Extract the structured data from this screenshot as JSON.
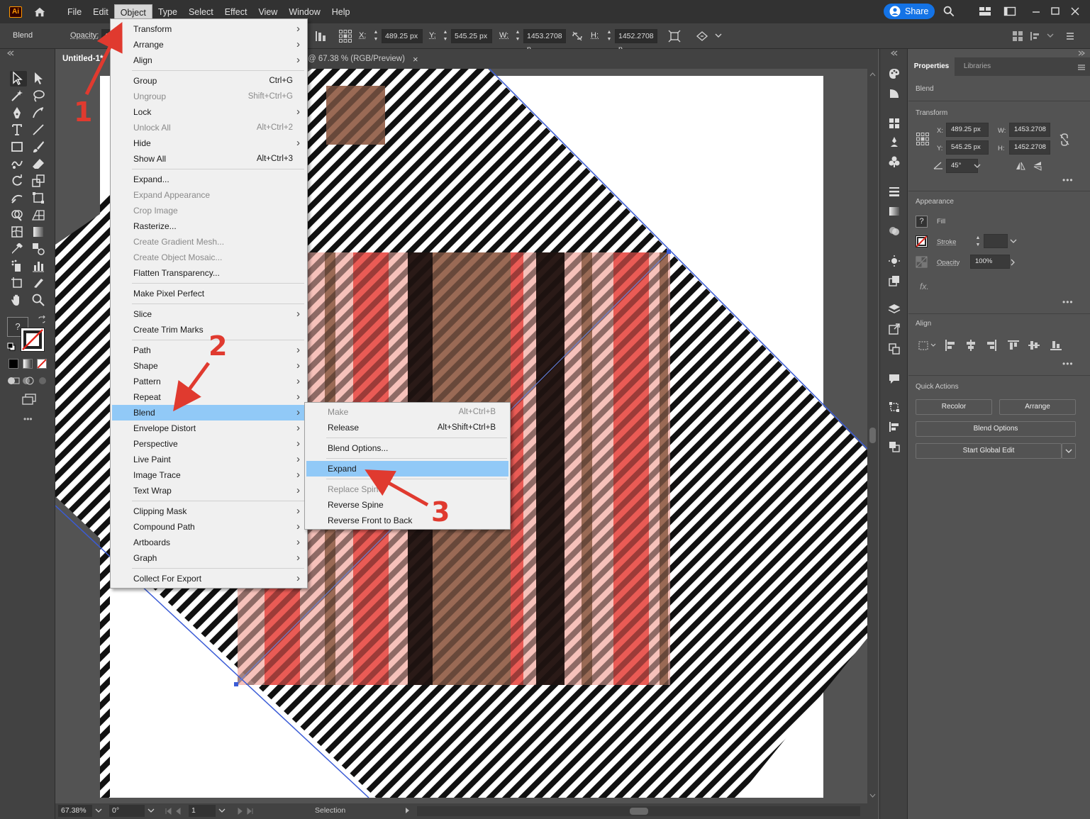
{
  "menubar": {
    "logo": "Ai",
    "items": [
      "File",
      "Edit",
      "Object",
      "Type",
      "Select",
      "Effect",
      "View",
      "Window",
      "Help"
    ],
    "active_item": "Object",
    "share_label": "Share"
  },
  "controlbar": {
    "selection_label": "Blend",
    "opacity_label": "Opacity:",
    "opacity_value": "10",
    "x_label": "X:",
    "x_value": "489.25 px",
    "y_label": "Y:",
    "y_value": "545.25 px",
    "w_label": "W:",
    "w_value": "1453.2708 p",
    "h_label": "H:",
    "h_value": "1452.2708 p"
  },
  "document": {
    "tab_title": "Untitled-1*",
    "tab_suffix": "@ 67.38 % (RGB/Preview)",
    "close_glyph": "×"
  },
  "object_menu": {
    "items": [
      {
        "label": "Transform",
        "shortcut": "",
        "submenu": true,
        "disabled": false
      },
      {
        "label": "Arrange",
        "shortcut": "",
        "submenu": true,
        "disabled": false
      },
      {
        "label": "Align",
        "shortcut": "",
        "submenu": true,
        "disabled": false
      },
      {
        "label": "Group",
        "shortcut": "Ctrl+G",
        "submenu": false,
        "disabled": false
      },
      {
        "label": "Ungroup",
        "shortcut": "Shift+Ctrl+G",
        "submenu": false,
        "disabled": true
      },
      {
        "label": "Lock",
        "shortcut": "",
        "submenu": true,
        "disabled": false
      },
      {
        "label": "Unlock All",
        "shortcut": "Alt+Ctrl+2",
        "submenu": false,
        "disabled": true
      },
      {
        "label": "Hide",
        "shortcut": "",
        "submenu": true,
        "disabled": false
      },
      {
        "label": "Show All",
        "shortcut": "Alt+Ctrl+3",
        "submenu": false,
        "disabled": false
      },
      {
        "label": "Expand...",
        "shortcut": "",
        "submenu": false,
        "disabled": false
      },
      {
        "label": "Expand Appearance",
        "shortcut": "",
        "submenu": false,
        "disabled": true
      },
      {
        "label": "Crop Image",
        "shortcut": "",
        "submenu": false,
        "disabled": true
      },
      {
        "label": "Rasterize...",
        "shortcut": "",
        "submenu": false,
        "disabled": false
      },
      {
        "label": "Create Gradient Mesh...",
        "shortcut": "",
        "submenu": false,
        "disabled": true
      },
      {
        "label": "Create Object Mosaic...",
        "shortcut": "",
        "submenu": false,
        "disabled": true
      },
      {
        "label": "Flatten Transparency...",
        "shortcut": "",
        "submenu": false,
        "disabled": false
      },
      {
        "label": "Make Pixel Perfect",
        "shortcut": "",
        "submenu": false,
        "disabled": false
      },
      {
        "label": "Slice",
        "shortcut": "",
        "submenu": true,
        "disabled": false
      },
      {
        "label": "Create Trim Marks",
        "shortcut": "",
        "submenu": false,
        "disabled": false
      },
      {
        "label": "Path",
        "shortcut": "",
        "submenu": true,
        "disabled": false
      },
      {
        "label": "Shape",
        "shortcut": "",
        "submenu": true,
        "disabled": false
      },
      {
        "label": "Pattern",
        "shortcut": "",
        "submenu": true,
        "disabled": false
      },
      {
        "label": "Repeat",
        "shortcut": "",
        "submenu": true,
        "disabled": false
      },
      {
        "label": "Blend",
        "shortcut": "",
        "submenu": true,
        "disabled": false,
        "highlight": true
      },
      {
        "label": "Envelope Distort",
        "shortcut": "",
        "submenu": true,
        "disabled": false
      },
      {
        "label": "Perspective",
        "shortcut": "",
        "submenu": true,
        "disabled": false
      },
      {
        "label": "Live Paint",
        "shortcut": "",
        "submenu": true,
        "disabled": false
      },
      {
        "label": "Image Trace",
        "shortcut": "",
        "submenu": true,
        "disabled": false
      },
      {
        "label": "Text Wrap",
        "shortcut": "",
        "submenu": true,
        "disabled": false
      },
      {
        "label": "Clipping Mask",
        "shortcut": "",
        "submenu": true,
        "disabled": false
      },
      {
        "label": "Compound Path",
        "shortcut": "",
        "submenu": true,
        "disabled": false
      },
      {
        "label": "Artboards",
        "shortcut": "",
        "submenu": true,
        "disabled": false
      },
      {
        "label": "Graph",
        "shortcut": "",
        "submenu": true,
        "disabled": false
      },
      {
        "label": "Collect For Export",
        "shortcut": "",
        "submenu": true,
        "disabled": false
      }
    ]
  },
  "blend_submenu": {
    "items": [
      {
        "label": "Make",
        "shortcut": "Alt+Ctrl+B",
        "disabled": true
      },
      {
        "label": "Release",
        "shortcut": "Alt+Shift+Ctrl+B",
        "disabled": false
      },
      {
        "label": "Blend Options...",
        "shortcut": "",
        "disabled": false
      },
      {
        "label": "Expand",
        "shortcut": "",
        "disabled": false,
        "highlight": true
      },
      {
        "label": "Replace Spine",
        "shortcut": "",
        "disabled": true
      },
      {
        "label": "Reverse Spine",
        "shortcut": "",
        "disabled": false
      },
      {
        "label": "Reverse Front to Back",
        "shortcut": "",
        "disabled": false
      }
    ]
  },
  "annotations": [
    "1",
    "2",
    "3"
  ],
  "properties_panel": {
    "tabs": [
      "Properties",
      "Libraries"
    ],
    "selection": "Blend",
    "transform_title": "Transform",
    "x_label": "X:",
    "x_value": "489.25 px",
    "y_label": "Y:",
    "y_value": "545.25 px",
    "w_label": "W:",
    "w_value": "1453.2708",
    "h_label": "H:",
    "h_value": "1452.2708",
    "angle_value": "45°",
    "appearance_title": "Appearance",
    "fill_label": "Fill",
    "fill_glyph": "?",
    "stroke_label": "Stroke",
    "opacity_label": "Opacity",
    "opacity_value": "100%",
    "fx_label": "fx.",
    "align_title": "Align",
    "quick_actions_title": "Quick Actions",
    "recolor_label": "Recolor",
    "arrange_label": "Arrange",
    "blend_options_label": "Blend Options",
    "global_edit_label": "Start Global Edit",
    "more_glyph": "•••"
  },
  "toolbar": {
    "fill_glyph": "?",
    "more_glyph": "•••"
  },
  "statusbar": {
    "zoom": "67.38%",
    "rotation": "0°",
    "artboard": "1",
    "tool": "Selection"
  },
  "colors": {
    "menubar": "#323232",
    "panel": "#424242",
    "workspace": "#535353",
    "menu_bg": "#f0f0f0",
    "menu_highlight": "#91c9f7",
    "share_blue": "#1473e6",
    "annotation_red": "#e03a2f",
    "stripe_pink": "#f4b6ae",
    "stripe_red": "#e9504a",
    "stripe_brown": "#9a6a55",
    "stripe_dark": "#2a1a17"
  }
}
